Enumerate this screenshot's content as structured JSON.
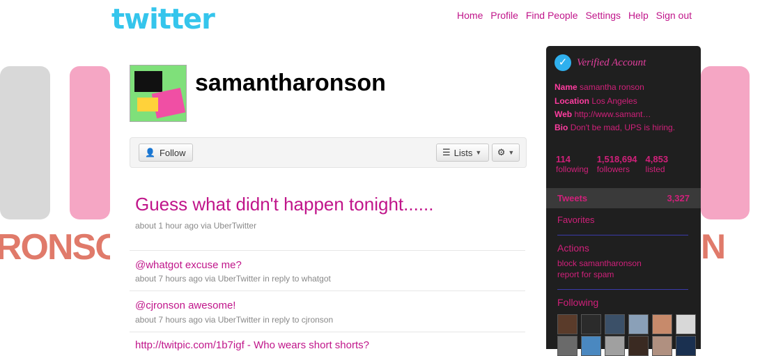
{
  "header": {
    "logo": "twitter",
    "nav": [
      "Home",
      "Profile",
      "Find People",
      "Settings",
      "Help",
      "Sign out"
    ]
  },
  "profile": {
    "username": "samantharonson",
    "follow_label": "Follow",
    "lists_label": "Lists"
  },
  "latest_tweet": {
    "text": "Guess what didn't happen tonight......",
    "meta": "about 1 hour ago via UberTwitter"
  },
  "tweets": [
    {
      "text": "@whatgot excuse me?",
      "meta": "about 7 hours ago via UberTwitter in reply to whatgot"
    },
    {
      "text": "@cjronson awesome!",
      "meta": "about 7 hours ago via UberTwitter in reply to cjronson"
    },
    {
      "text": "http://twitpic.com/1b7igf - Who wears short shorts?",
      "meta": ""
    }
  ],
  "sidebar": {
    "verified": "Verified Account",
    "name_label": "Name",
    "name": "samantha ronson",
    "location_label": "Location",
    "location": "Los Angeles",
    "web_label": "Web",
    "web": "http://www.samant…",
    "bio_label": "Bio",
    "bio": "Don't be mad, UPS is hiring.",
    "stats": [
      {
        "num": "114",
        "label": "following"
      },
      {
        "num": "1,518,694",
        "label": "followers"
      },
      {
        "num": "4,853",
        "label": "listed"
      }
    ],
    "tweets_label": "Tweets",
    "tweets_count": "3,327",
    "favorites": "Favorites",
    "actions_heading": "Actions",
    "actions": [
      "block samantharonson",
      "report for spam"
    ],
    "following_heading": "Following",
    "face_colors": [
      "#5a3b2a",
      "#2b2b2b",
      "#3b5068",
      "#8aa0b8",
      "#c78a6b",
      "#d8d8d8"
    ]
  },
  "side_art": {
    "text": "RONSON"
  }
}
